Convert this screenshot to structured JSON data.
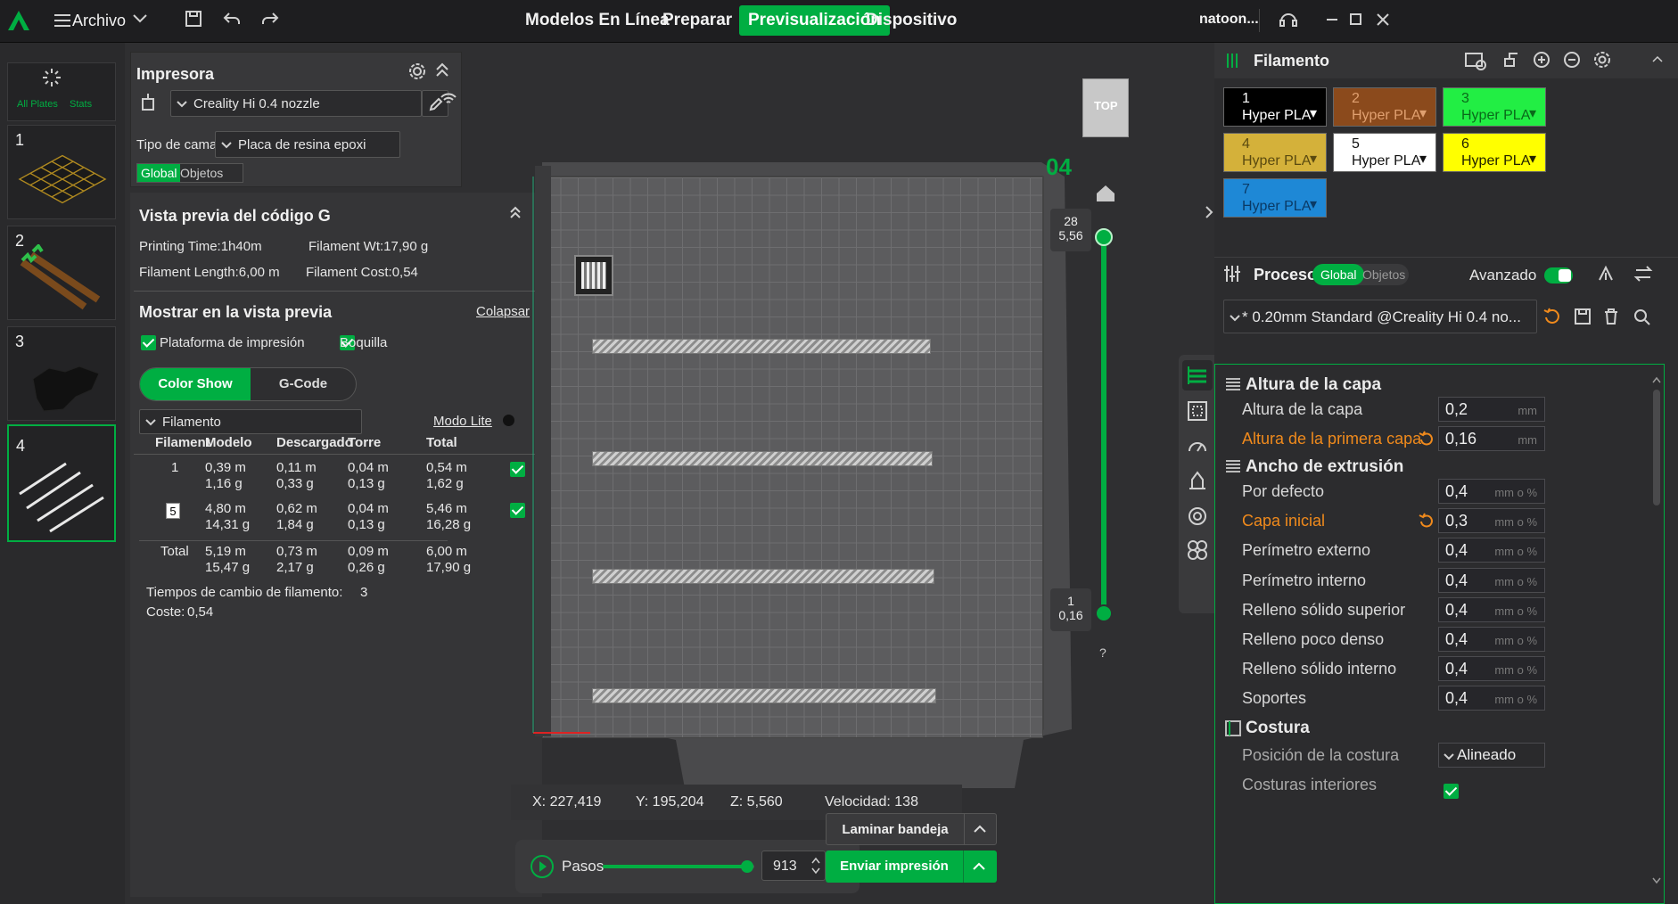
{
  "topbar": {
    "menu_label": "Archivo",
    "tabs": [
      "Modelos En Línea",
      "Preparar",
      "Previsualización",
      "Dispositivo"
    ],
    "active_tab": "Previsualización",
    "user": "natoon..."
  },
  "plates": {
    "all_plates": "All Plates",
    "stats": "Stats",
    "items": [
      "1",
      "2",
      "3",
      "4"
    ]
  },
  "printer": {
    "title": "Impresora",
    "printer_name": "Creality Hi 0.4 nozzle",
    "bed_label": "Tipo de cama",
    "bed_value": "Placa de resina epoxi",
    "tab_global": "Global",
    "tab_objects": "Objetos"
  },
  "gcode": {
    "title": "Vista previa del código G",
    "printing_time": "Printing Time:1h40m",
    "filament_wt": "Filament Wt:17,90 g",
    "filament_length": "Filament Length:6,00 m",
    "filament_cost": "Filament Cost:0,54",
    "show_title": "Mostrar en la vista previa",
    "collapse": "Colapsar",
    "check_platform": "Plataforma de impresión",
    "check_nozzle": "Boquilla",
    "btn_color_show": "Color Show",
    "btn_gcode": "G-Code",
    "dropdown": "Filamento",
    "lite_mode": "Modo Lite",
    "headers": [
      "Filamento",
      "Modelo",
      "Descargado",
      "Torre",
      "Total"
    ],
    "rows": [
      {
        "id": "1",
        "modelo": [
          "0,39 m",
          "1,16 g"
        ],
        "descargado": [
          "0,11 m",
          "0,33 g"
        ],
        "torre": [
          "0,04 m",
          "0,13 g"
        ],
        "total": [
          "0,54 m",
          "1,62 g"
        ]
      },
      {
        "id": "5",
        "modelo": [
          "4,80 m",
          "14,31 g"
        ],
        "descargado": [
          "0,62 m",
          "1,84 g"
        ],
        "torre": [
          "0,04 m",
          "0,13 g"
        ],
        "total": [
          "5,46 m",
          "16,28 g"
        ]
      }
    ],
    "total_row": {
      "id": "Total",
      "modelo": [
        "5,19 m",
        "15,47 g"
      ],
      "descargado": [
        "0,73 m",
        "2,17 g"
      ],
      "torre": [
        "0,09 m",
        "0,26 g"
      ],
      "total": [
        "6,00 m",
        "17,90 g"
      ]
    },
    "changes_label": "Tiempos de cambio de filamento:",
    "changes_value": "3",
    "cost_label": "Coste:",
    "cost_value": "0,54"
  },
  "viewport": {
    "view_cube": "TOP",
    "plate_number": "04",
    "layer_top": "28",
    "layer_top_z": "5,56",
    "layer_bottom": "1",
    "layer_bottom_z": "0,16",
    "help": "?",
    "coord_x": "X: 227,419",
    "coord_y": "Y: 195,204",
    "coord_z": "Z: 5,560",
    "speed": "Velocidad: 138",
    "steps_label": "Pasos",
    "steps_value": "913",
    "steps_fraction": 0.95,
    "btn_slice": "Laminar bandeja",
    "btn_send": "Enviar impresión"
  },
  "filament": {
    "title": "Filamento",
    "slots": [
      {
        "num": "1",
        "name": "Hyper PLA",
        "color": "#000000",
        "text": "#ffffff"
      },
      {
        "num": "2",
        "name": "Hyper PLA",
        "color": "#8b4a1c",
        "text": "#e0a070"
      },
      {
        "num": "3",
        "name": "Hyper PLA",
        "color": "#22ee44",
        "text": "#0a6a1a"
      },
      {
        "num": "4",
        "name": "Hyper PLA",
        "color": "#d4b13a",
        "text": "#5a4a10"
      },
      {
        "num": "5",
        "name": "Hyper PLA",
        "color": "#ffffff",
        "text": "#111111"
      },
      {
        "num": "6",
        "name": "Hyper PLA",
        "color": "#ffff00",
        "text": "#222200"
      },
      {
        "num": "7",
        "name": "Hyper PLA",
        "color": "#1e88d6",
        "text": "#0a3a66"
      }
    ]
  },
  "process": {
    "title": "Proceso",
    "tab_global": "Global",
    "tab_objects": "Objetos",
    "advanced": "Avanzado",
    "preset": "* 0.20mm Standard @Creality Hi 0.4 no...",
    "groups": {
      "layer_height": "Altura de la capa",
      "extrusion_width": "Ancho de extrusión",
      "seam": "Costura"
    },
    "layer_rows": [
      {
        "label": "Altura de la capa",
        "value": "0,2",
        "unit": "mm",
        "modified": false
      },
      {
        "label": "Altura de la primera capa",
        "value": "0,16",
        "unit": "mm",
        "modified": true
      }
    ],
    "width_rows": [
      {
        "label": "Por defecto",
        "value": "0,4",
        "unit": "mm o %",
        "modified": false
      },
      {
        "label": "Capa inicial",
        "value": "0,3",
        "unit": "mm o %",
        "modified": true
      },
      {
        "label": "Perímetro externo",
        "value": "0,4",
        "unit": "mm o %",
        "modified": false
      },
      {
        "label": "Perímetro interno",
        "value": "0,4",
        "unit": "mm o %",
        "modified": false
      },
      {
        "label": "Relleno sólido superior",
        "value": "0,4",
        "unit": "mm o %",
        "modified": false
      },
      {
        "label": "Relleno poco denso",
        "value": "0,4",
        "unit": "mm o %",
        "modified": false
      },
      {
        "label": "Relleno sólido interno",
        "value": "0,4",
        "unit": "mm o %",
        "modified": false
      },
      {
        "label": "Soportes",
        "value": "0,4",
        "unit": "mm o %",
        "modified": false
      }
    ],
    "seam_position_label": "Posición de la costura",
    "seam_position_value": "Alineado",
    "inner_seams_label": "Costuras interiores"
  }
}
